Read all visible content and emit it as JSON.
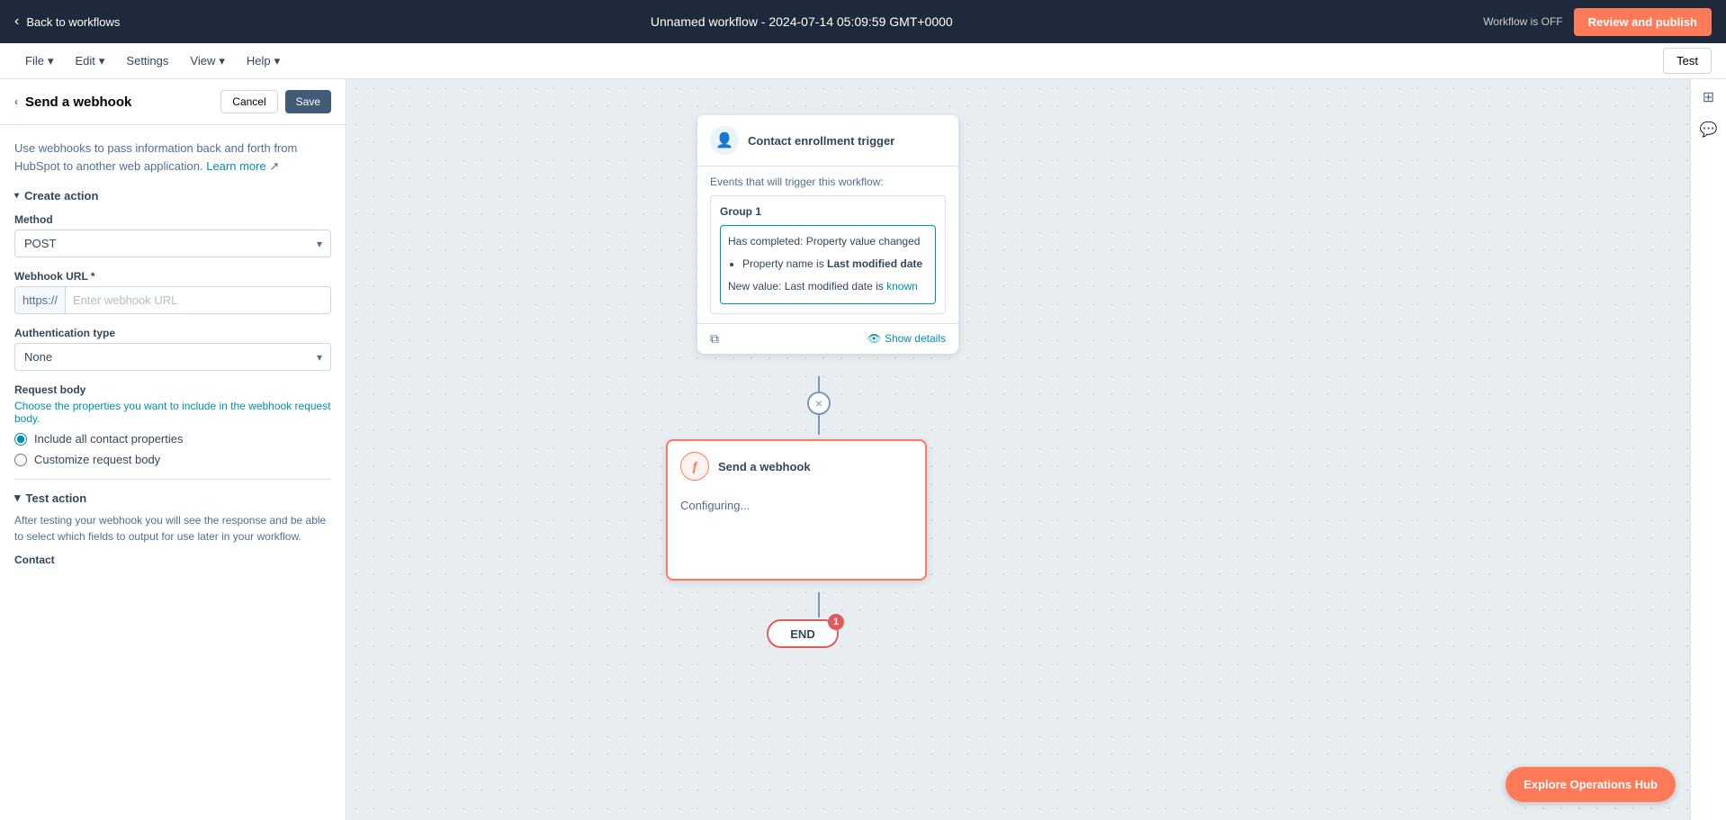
{
  "topNav": {
    "back_label": "Back to workflows",
    "title": "Unnamed workflow - 2024-07-14 05:09:59 GMT+0000",
    "workflow_status": "Workflow is OFF",
    "review_publish_label": "Review and publish",
    "test_label": "Test"
  },
  "secondaryNav": {
    "items": [
      {
        "label": "File",
        "has_dropdown": true
      },
      {
        "label": "Edit",
        "has_dropdown": true
      },
      {
        "label": "Settings",
        "has_dropdown": false
      },
      {
        "label": "View",
        "has_dropdown": true
      },
      {
        "label": "Help",
        "has_dropdown": true
      }
    ]
  },
  "leftPanel": {
    "title": "Send a webhook",
    "cancel_label": "Cancel",
    "save_label": "Save",
    "description": "Use webhooks to pass information back and forth from HubSpot to another web application.",
    "learn_more_label": "Learn more",
    "create_action_label": "Create action",
    "method_label": "Method",
    "method_value": "POST",
    "webhook_url_label": "Webhook URL *",
    "webhook_prefix": "https://",
    "webhook_placeholder": "Enter webhook URL",
    "auth_type_label": "Authentication type",
    "auth_type_value": "None",
    "request_body_label": "Request body",
    "request_body_desc": "Choose the properties you want to include in the webhook request body.",
    "radio_all_label": "Include all contact properties",
    "radio_customize_label": "Customize request body",
    "test_action_label": "Test action",
    "test_desc": "After testing your webhook you will see the response and be able to select which fields to output for use later in your workflow.",
    "contact_label": "Contact"
  },
  "canvas": {
    "trigger": {
      "icon": "👤",
      "title": "Contact enrollment trigger",
      "subtitle": "Events that will trigger this workflow:",
      "group_label": "Group 1",
      "condition_title": "Has completed: Property value changed",
      "condition_items": [
        {
          "key": "Property name",
          "op": "is",
          "value": "Last modified date"
        }
      ],
      "new_value_label": "New value: Last modified date",
      "new_value_suffix": "is",
      "new_value_status": "known",
      "show_details_label": "Show details"
    },
    "action": {
      "icon": "ƒ",
      "title": "Send a webhook",
      "status": "Configuring..."
    },
    "end": {
      "label": "END",
      "badge": "1"
    }
  },
  "rightSidebar": {
    "grid_icon": "⊞",
    "chat_icon": "💬"
  },
  "exploreBtn": {
    "label": "Explore Operations Hub"
  }
}
